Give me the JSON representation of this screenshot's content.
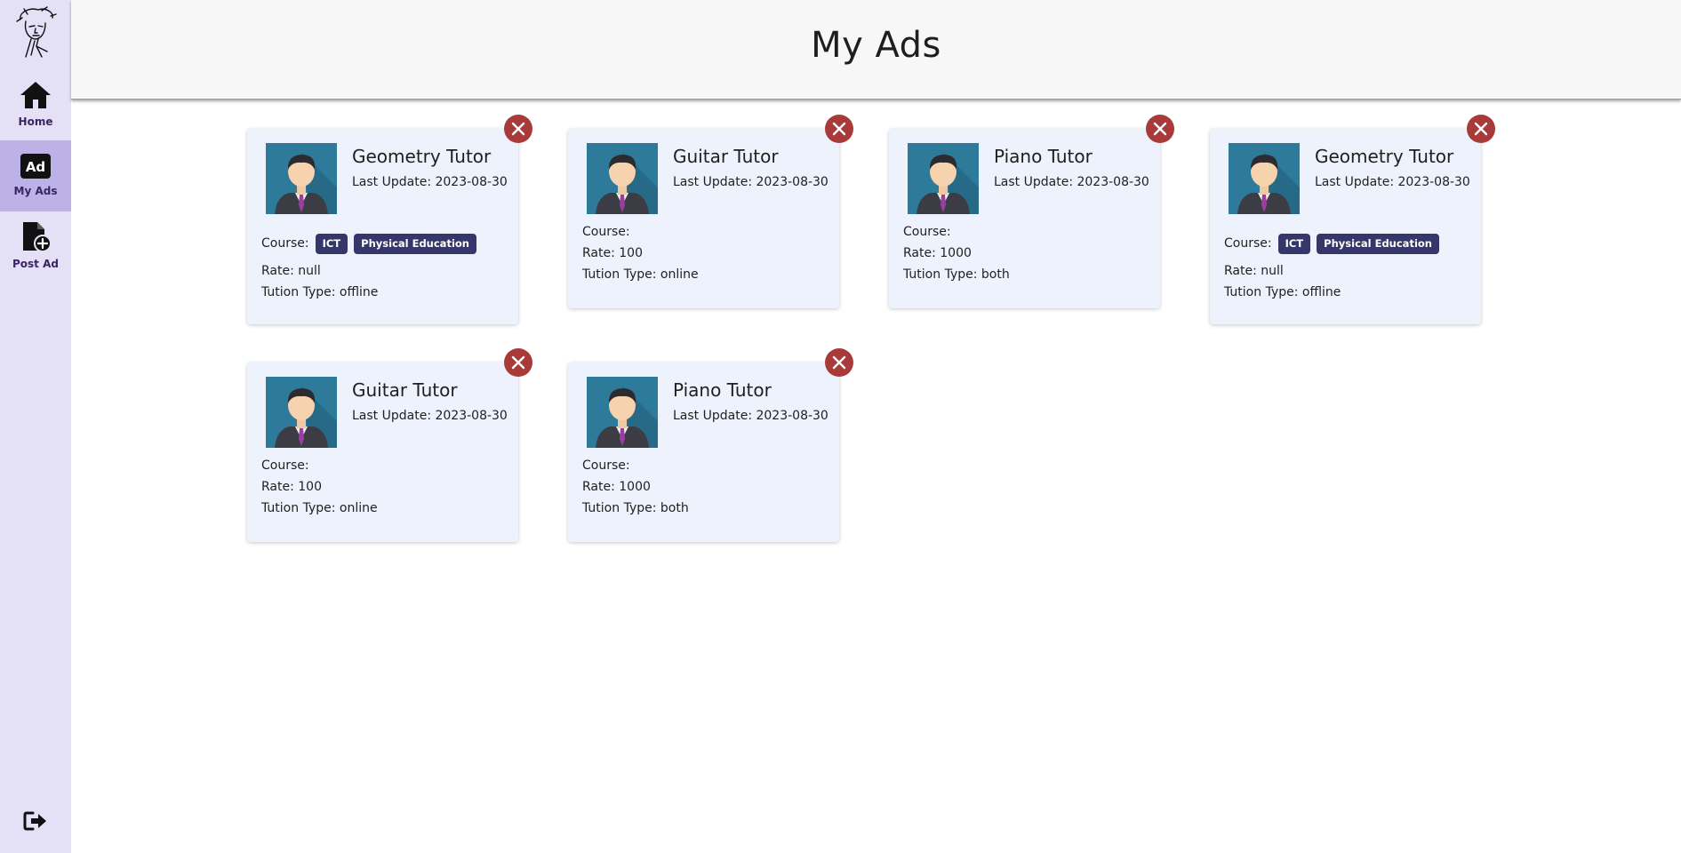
{
  "sidebar": {
    "items": [
      {
        "label": "Home",
        "icon": "home-icon",
        "active": false
      },
      {
        "label": "My Ads",
        "icon": "ad-icon",
        "active": true
      },
      {
        "label": "Post Ad",
        "icon": "post-ad-icon",
        "active": false
      }
    ],
    "logout_icon": "logout-icon"
  },
  "header": {
    "title": "My Ads"
  },
  "labels": {
    "last_update": "Last Update:",
    "course": "Course:",
    "rate": "Rate:",
    "tution_type": "Tution Type:"
  },
  "ads": [
    {
      "title": "Geometry Tutor",
      "last_update": "Last Update: 2023-08-30",
      "course_label": "Course:",
      "courses": [
        "ICT",
        "Physical Education"
      ],
      "rate": "Rate: null",
      "tution_type": "Tution Type: offline"
    },
    {
      "title": "Guitar Tutor",
      "last_update": "Last Update: 2023-08-30",
      "course_label": "Course:",
      "courses": [],
      "rate": "Rate: 100",
      "tution_type": "Tution Type: online"
    },
    {
      "title": "Piano Tutor",
      "last_update": "Last Update: 2023-08-30",
      "course_label": "Course:",
      "courses": [],
      "rate": "Rate: 1000",
      "tution_type": "Tution Type: both"
    },
    {
      "title": "Geometry Tutor",
      "last_update": "Last Update: 2023-08-30",
      "course_label": "Course:",
      "courses": [
        "ICT",
        "Physical Education"
      ],
      "rate": "Rate: null",
      "tution_type": "Tution Type: offline"
    },
    {
      "title": "Guitar Tutor",
      "last_update": "Last Update: 2023-08-30",
      "course_label": "Course:",
      "courses": [],
      "rate": "Rate: 100",
      "tution_type": "Tution Type: online"
    },
    {
      "title": "Piano Tutor",
      "last_update": "Last Update: 2023-08-30",
      "course_label": "Course:",
      "courses": [],
      "rate": "Rate: 1000",
      "tution_type": "Tution Type: both"
    }
  ],
  "colors": {
    "sidebar_bg": "#e4e1f6",
    "sidebar_active": "#bcb2e8",
    "card_bg": "#eef2fd",
    "close_button": "#a83a3a",
    "chip": "#35376a"
  }
}
